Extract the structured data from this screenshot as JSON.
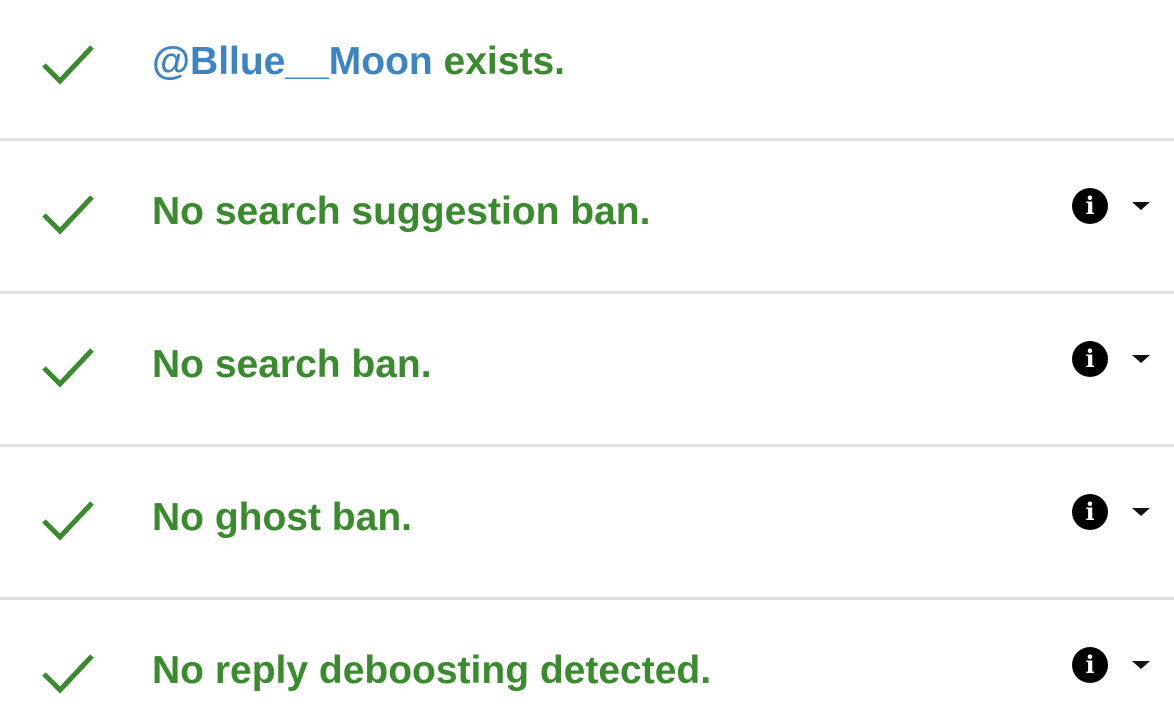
{
  "colors": {
    "success_green": "#3a8a2e",
    "handle_blue": "#3c84c4",
    "divider": "#e0e0e0"
  },
  "rows": [
    {
      "icon": "check-icon",
      "handle": "@Bllue__Moon",
      "text": " exists."
    },
    {
      "icon": "check-icon",
      "text": "No search suggestion ban.",
      "has_info": true
    },
    {
      "icon": "check-icon",
      "text": "No search ban.",
      "has_info": true
    },
    {
      "icon": "check-icon",
      "text": "No ghost ban.",
      "has_info": true
    },
    {
      "icon": "check-icon",
      "text": "No reply deboosting detected.",
      "has_info": true
    }
  ],
  "info_icon": "info-icon",
  "expand_icon": "caret-down-icon"
}
